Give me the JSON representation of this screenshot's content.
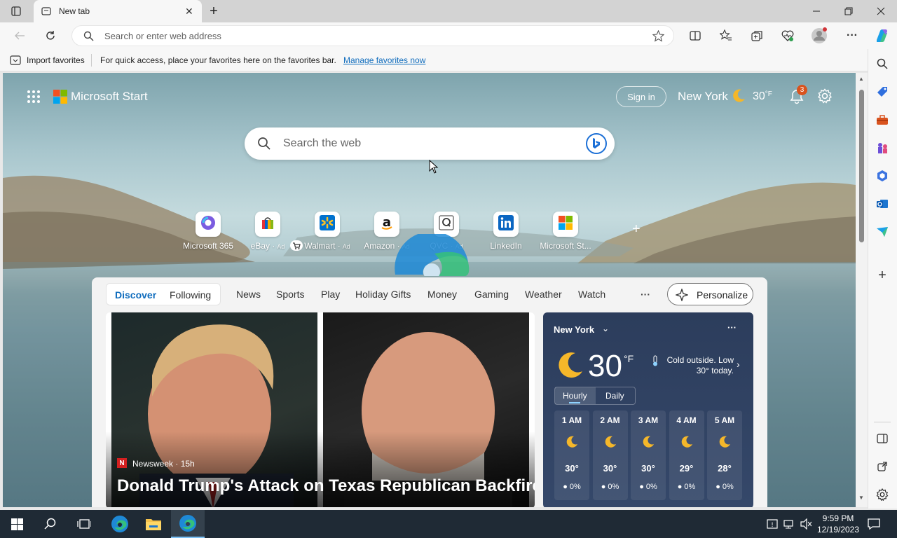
{
  "browser": {
    "tab_title": "New tab",
    "address_placeholder": "Search or enter web address"
  },
  "favorites_bar": {
    "import_label": "Import favorites",
    "message": "For quick access, place your favorites here on the favorites bar.",
    "manage_link": "Manage favorites now"
  },
  "page": {
    "brand": "Microsoft Start",
    "sign_in": "Sign in",
    "weather_city": "New York",
    "weather_temp": "30",
    "weather_unit": "°F",
    "notification_count": "3",
    "search_placeholder": "Search the web"
  },
  "quick_links": [
    {
      "label": "Microsoft 365",
      "ad": ""
    },
    {
      "label": "eBay",
      "ad": "Ad"
    },
    {
      "label": "Walmart",
      "ad": "Ad"
    },
    {
      "label": "Amazon",
      "ad": "Ad"
    },
    {
      "label": "QVC",
      "ad": "Ad"
    },
    {
      "label": "LinkedIn",
      "ad": ""
    },
    {
      "label": "Microsoft St...",
      "ad": ""
    }
  ],
  "feed_tabs": {
    "discover": "Discover",
    "following": "Following",
    "items": [
      "News",
      "Sports",
      "Play",
      "Holiday Gifts",
      "Money",
      "Gaming",
      "Weather",
      "Watch"
    ],
    "more": "···",
    "personalize": "Personalize"
  },
  "headline": {
    "source": "Newsweek",
    "age": "15h",
    "title": "Donald Trump's Attack on Texas Republican Backfires"
  },
  "weather_card": {
    "city": "New York",
    "temp": "30",
    "unit": "°F",
    "summary": "Cold outside. Low 30° today.",
    "tab_hourly": "Hourly",
    "tab_daily": "Daily",
    "hours": [
      {
        "time": "1 AM",
        "temp": "30°",
        "precip": "0%"
      },
      {
        "time": "2 AM",
        "temp": "30°",
        "precip": "0%"
      },
      {
        "time": "3 AM",
        "temp": "30°",
        "precip": "0%"
      },
      {
        "time": "4 AM",
        "temp": "29°",
        "precip": "0%"
      },
      {
        "time": "5 AM",
        "temp": "28°",
        "precip": "0%"
      }
    ]
  },
  "taskbar": {
    "time": "9:59 PM",
    "date": "12/19/2023"
  },
  "colors": {
    "accent": "#0f6cbd",
    "link": "#0f6cbd",
    "taskbar": "#1f2a35",
    "weather_card": "#2b3a55"
  }
}
